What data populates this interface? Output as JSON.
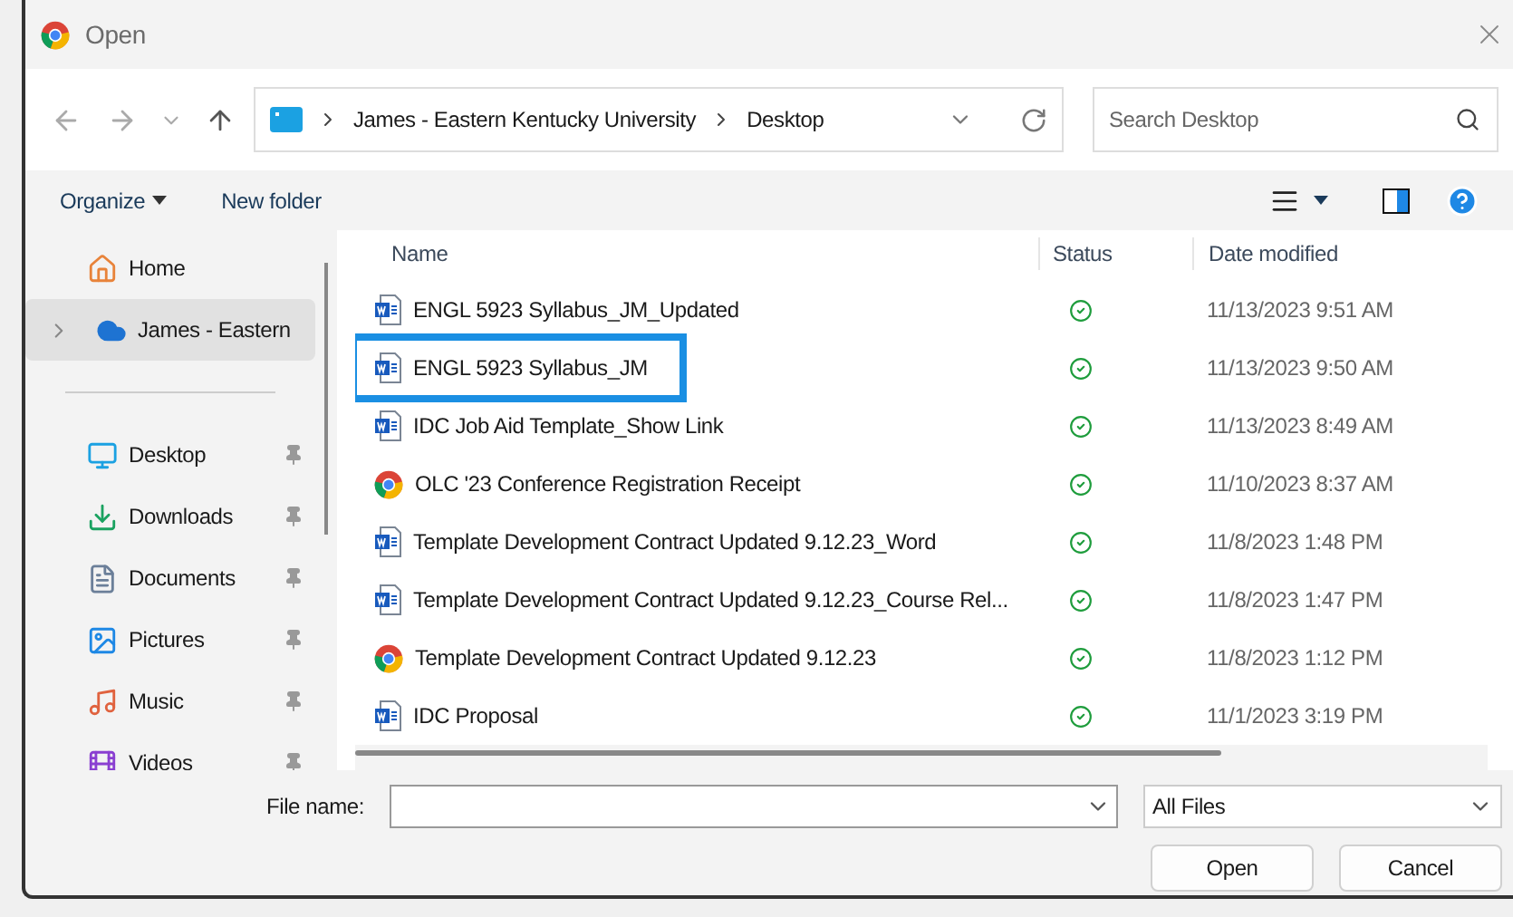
{
  "window": {
    "title": "Open"
  },
  "address": {
    "crumbs": [
      "James - Eastern Kentucky University",
      "Desktop"
    ]
  },
  "search": {
    "placeholder": "Search Desktop"
  },
  "toolbar": {
    "organize": "Organize",
    "new_folder": "New folder"
  },
  "sidebar": {
    "items": [
      {
        "label": "Home",
        "kind": "home",
        "selected": false,
        "pinned": false,
        "expandable": false
      },
      {
        "label": "James - Eastern",
        "kind": "cloud",
        "selected": true,
        "pinned": false,
        "expandable": true
      },
      {
        "label": "Desktop",
        "kind": "desktop",
        "selected": false,
        "pinned": true,
        "expandable": false
      },
      {
        "label": "Downloads",
        "kind": "downloads",
        "selected": false,
        "pinned": true,
        "expandable": false
      },
      {
        "label": "Documents",
        "kind": "documents",
        "selected": false,
        "pinned": true,
        "expandable": false
      },
      {
        "label": "Pictures",
        "kind": "pictures",
        "selected": false,
        "pinned": true,
        "expandable": false
      },
      {
        "label": "Music",
        "kind": "music",
        "selected": false,
        "pinned": true,
        "expandable": false
      },
      {
        "label": "Videos",
        "kind": "videos",
        "selected": false,
        "pinned": true,
        "expandable": false
      }
    ]
  },
  "table": {
    "columns": [
      "Name",
      "Status",
      "Date modified"
    ],
    "rows": [
      {
        "name": "ENGL 5923 Syllabus_JM_Updated",
        "kind": "word",
        "date": "11/13/2023 9:51 AM",
        "selected": false
      },
      {
        "name": "ENGL 5923 Syllabus_JM",
        "kind": "word",
        "date": "11/13/2023 9:50 AM",
        "selected": true
      },
      {
        "name": "IDC Job Aid Template_Show Link",
        "kind": "word",
        "date": "11/13/2023 8:49 AM",
        "selected": false
      },
      {
        "name": "OLC '23 Conference Registration Receipt",
        "kind": "chrome",
        "date": "11/10/2023 8:37 AM",
        "selected": false
      },
      {
        "name": "Template Development Contract Updated 9.12.23_Word",
        "kind": "word",
        "date": "11/8/2023 1:48 PM",
        "selected": false
      },
      {
        "name": "Template Development Contract Updated 9.12.23_Course Rel...",
        "kind": "word",
        "date": "11/8/2023 1:47 PM",
        "selected": false
      },
      {
        "name": "Template Development Contract Updated 9.12.23",
        "kind": "chrome",
        "date": "11/8/2023 1:12 PM",
        "selected": false
      },
      {
        "name": "IDC Proposal",
        "kind": "word",
        "date": "11/1/2023 3:19 PM",
        "selected": false
      }
    ]
  },
  "file_name": {
    "label": "File name:"
  },
  "file_type": {
    "value": "All Files"
  },
  "buttons": [
    "Open",
    "Cancel"
  ]
}
